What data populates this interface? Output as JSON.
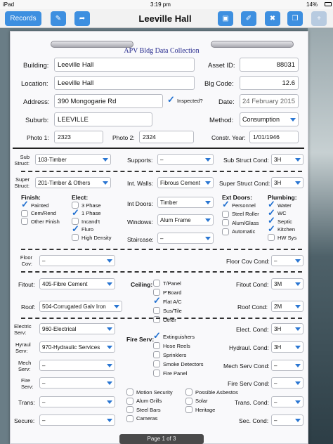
{
  "status": {
    "device": "iPad",
    "time": "3:19 pm",
    "battery": "14%"
  },
  "nav": {
    "records_label": "Records",
    "title": "Leeville Hall"
  },
  "doc_title": "APV Bldg Data Collection",
  "labels": {
    "building": "Building:",
    "asset_id": "Asset ID:",
    "location": "Location:",
    "blg_code": "Blg Code:",
    "address": "Address:",
    "inspected": "Inspected?",
    "date": "Date:",
    "suburb": "Suburb:",
    "method": "Method:",
    "photo1": "Photo 1:",
    "photo2": "Photo 2:",
    "constr_year": "Constr. Year:",
    "sub_struct": "Sub Struct:",
    "supports": "Supports:",
    "sub_struct_cond": "Sub Struct Cond:",
    "super_struct": "Super Struct:",
    "int_walls": "Int. Walls:",
    "super_struct_cond": "Super Struct Cond:",
    "finish": "Finish:",
    "elect": "Elect:",
    "int_doors": "Int Doors:",
    "windows": "Windows:",
    "staircase": "Staircase:",
    "ext_doors": "Ext Doors:",
    "plumbing": "Plumbing:",
    "floor_cov": "Floor Cov:",
    "floor_cov_cond": "Floor Cov Cond:",
    "fitout": "Fitout:",
    "ceiling": "Ceiling:",
    "fitout_cond": "Fitout Cond:",
    "roof": "Roof:",
    "roof_cond": "Roof Cond:",
    "electric_serv": "Electric Serv:",
    "elect_cond": "Elect. Cond:",
    "hydraul_serv": "Hyraul Serv:",
    "hydraul_cond": "Hydraul. Cond:",
    "fire_serv_chk": "Fire Serv:",
    "mech_serv": "Mech Serv:",
    "mech_serv_cond": "Mech Serv Cond:",
    "fire_serv": "Fire Serv:",
    "fire_serv_cond": "Fire Serv Cond:",
    "trans": "Trans:",
    "trans_cond": "Trans. Cond:",
    "secure": "Secure:",
    "sec_cond": "Sec. Cond:"
  },
  "values": {
    "building": "Leeville Hall",
    "asset_id": "88031",
    "location": "Leeville Hall",
    "blg_code": "12.6",
    "address": "390 Mongogarie Rd",
    "date": "24 February 2015",
    "suburb": "LEEVILLE",
    "method": "Consumption",
    "photo1": "2323",
    "photo2": "2324",
    "constr_year": "1/01/1946",
    "sub_struct": "103-Timber",
    "supports": "–",
    "sub_struct_cond": "3H",
    "super_struct": "201-Timber & Others",
    "int_walls": "Fibrous Cement",
    "super_struct_cond": "3H",
    "int_doors": "Timber",
    "windows": "Alum Frame",
    "staircase": "–",
    "floor_cov": "–",
    "floor_cov_cond": "–",
    "fitout": "405-Fibre Cement",
    "fitout_cond": "3M",
    "roof": "504-Corrugated Galv Iron",
    "roof_cond": "2M",
    "electric_serv": "960-Electrical",
    "elect_cond": "3H",
    "hydraul_serv": "970-Hydraulic Services",
    "hydraul_cond": "3H",
    "mech_serv": "–",
    "mech_serv_cond": "–",
    "fire_serv": "–",
    "fire_serv_cond": "–",
    "trans": "–",
    "trans_cond": "–",
    "secure": "–",
    "sec_cond": "–"
  },
  "checks": {
    "inspected": true,
    "finish": [
      {
        "label": "Painted",
        "on": true
      },
      {
        "label": "Cem/Rend",
        "on": false
      },
      {
        "label": "Other Finish",
        "on": false
      }
    ],
    "elect": [
      {
        "label": "3 Phase",
        "on": false
      },
      {
        "label": "1 Phase",
        "on": true
      },
      {
        "label": "Incand't",
        "on": false
      },
      {
        "label": "Fluro",
        "on": true
      },
      {
        "label": "High Density",
        "on": false
      }
    ],
    "ext_doors": [
      {
        "label": "Personnel",
        "on": true
      },
      {
        "label": "Steel Roller",
        "on": false
      },
      {
        "label": "Alum/Glass",
        "on": false
      },
      {
        "label": "Automatic",
        "on": false
      }
    ],
    "plumbing": [
      {
        "label": "Water",
        "on": true
      },
      {
        "label": "WC",
        "on": true
      },
      {
        "label": "Septic",
        "on": true
      },
      {
        "label": "Kitchen",
        "on": true
      },
      {
        "label": "HW Sys",
        "on": false
      }
    ],
    "ceiling": [
      {
        "label": "T/Panel",
        "on": false
      },
      {
        "label": "P'Board",
        "on": false
      },
      {
        "label": "Flat A/C",
        "on": true
      },
      {
        "label": "Sus/Tile",
        "on": false
      },
      {
        "label": "Other",
        "on": false
      }
    ],
    "fire_serv": [
      {
        "label": "Extinguishers",
        "on": true
      },
      {
        "label": "Hose Reels",
        "on": false
      },
      {
        "label": "Sprinklers",
        "on": false
      },
      {
        "label": "Smoke Detectors",
        "on": false
      },
      {
        "label": "Fire Panel",
        "on": false
      }
    ],
    "security_a": [
      {
        "label": "Motion Security",
        "on": false
      },
      {
        "label": "Alum Grills",
        "on": false
      },
      {
        "label": "Steel Bars",
        "on": false
      },
      {
        "label": "Cameras",
        "on": false
      }
    ],
    "security_b": [
      {
        "label": "Possible Asbestos",
        "on": false
      },
      {
        "label": "Solar",
        "on": false
      },
      {
        "label": "Heritage",
        "on": false
      }
    ]
  },
  "pager": "Page 1 of 3"
}
